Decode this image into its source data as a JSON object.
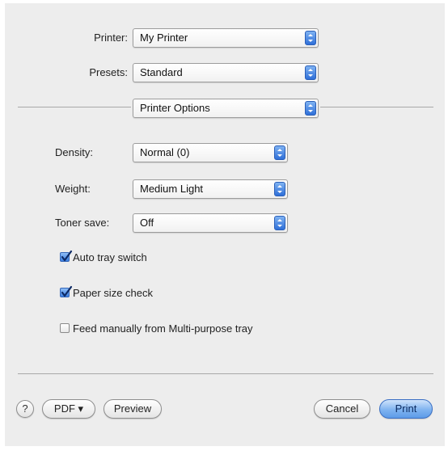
{
  "printer": {
    "label": "Printer:",
    "value": "My Printer"
  },
  "presets": {
    "label": "Presets:",
    "value": "Standard"
  },
  "section": {
    "value": "Printer Options"
  },
  "options": {
    "density": {
      "label": "Density:",
      "value": "Normal (0)"
    },
    "weight": {
      "label": "Weight:",
      "value": "Medium Light"
    },
    "toner": {
      "label": "Toner save:",
      "value": "Off"
    }
  },
  "checkboxes": [
    {
      "label": "Auto tray switch",
      "checked": true
    },
    {
      "label": "Paper size check",
      "checked": true
    },
    {
      "label": "Feed manually from Multi-purpose tray",
      "checked": false
    }
  ],
  "footer": {
    "help": "?",
    "pdf": "PDF ▾",
    "preview": "Preview",
    "cancel": "Cancel",
    "print": "Print"
  },
  "colors": {
    "accent": "#3c7fe0",
    "dialog_bg": "#ededed"
  },
  "icons": {
    "popup_arrows": "up-down-arrows-icon",
    "checkmark": "checkmark-icon"
  }
}
